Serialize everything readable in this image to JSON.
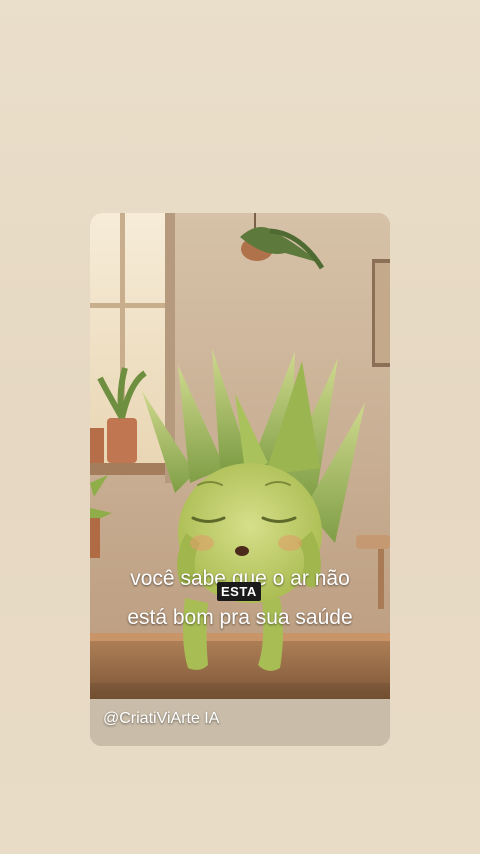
{
  "video": {
    "caption_line_1": "você sabe que o ar não",
    "caption_line_2": "está bom pra sua saúde",
    "sticker_text": "ESTA",
    "watermark": "@CriatiViArte IA"
  },
  "colors": {
    "background": "#e9dcc7",
    "plant_green": "#9cbb4f",
    "caption_text": "#ffffff"
  }
}
